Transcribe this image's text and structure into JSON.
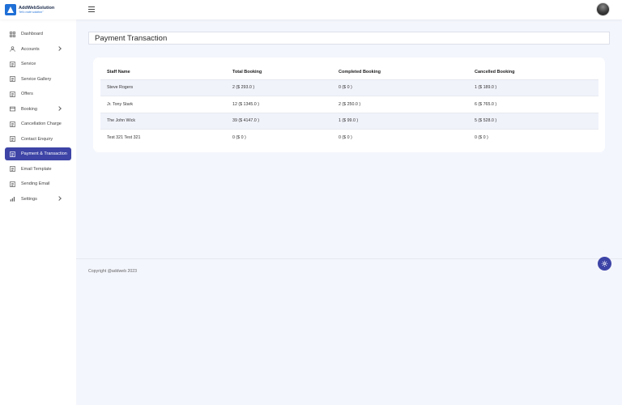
{
  "app": {
    "brand_name": "AddWebSolution",
    "brand_tagline": "\"let's code solution\""
  },
  "sidebar": {
    "items": [
      {
        "label": "Dashboard",
        "icon": "grid-icon",
        "has_children": false,
        "active": false
      },
      {
        "label": "Accounts",
        "icon": "user-icon",
        "has_children": true,
        "active": false
      },
      {
        "label": "Service",
        "icon": "document-icon",
        "has_children": false,
        "active": false
      },
      {
        "label": "Service Gallery",
        "icon": "document-icon",
        "has_children": false,
        "active": false
      },
      {
        "label": "Offers",
        "icon": "document-icon",
        "has_children": false,
        "active": false
      },
      {
        "label": "Booking",
        "icon": "card-icon",
        "has_children": true,
        "active": false
      },
      {
        "label": "Cancellation Charge",
        "icon": "document-icon",
        "has_children": false,
        "active": false
      },
      {
        "label": "Contact Enquiry",
        "icon": "document-icon",
        "has_children": false,
        "active": false
      },
      {
        "label": "Payment & Transaction",
        "icon": "document-icon",
        "has_children": false,
        "active": true
      },
      {
        "label": "Email Template",
        "icon": "document-icon",
        "has_children": false,
        "active": false
      },
      {
        "label": "Sending Email",
        "icon": "document-icon",
        "has_children": false,
        "active": false
      },
      {
        "label": "Settings",
        "icon": "bar-chart-icon",
        "has_children": true,
        "active": false
      }
    ]
  },
  "page": {
    "title": "Payment Transaction"
  },
  "table": {
    "headers": {
      "staff": "Staff Name",
      "total": "Total Booking",
      "completed": "Completed Booking",
      "cancelled": "Cancelled Booking"
    },
    "rows": [
      {
        "staff": "Steve Rogers",
        "total": "2 ($ 293.0 )",
        "completed": "0 ($ 0 )",
        "cancelled": "1 ($ 189.0 )"
      },
      {
        "staff": "Jr. Tony Stark",
        "total": "12 ($ 1345.0 )",
        "completed": "2 ($ 250.0 )",
        "cancelled": "6 ($ 765.0 )"
      },
      {
        "staff": "The John Wick",
        "total": "39 ($ 4147.0 )",
        "completed": "1 ($ 99.0 )",
        "cancelled": "5 ($ 528.0 )"
      },
      {
        "staff": "Test 321 Test 321",
        "total": "0 ($ 0 )",
        "completed": "0 ($ 0 )",
        "cancelled": "0 ($ 0 )"
      }
    ]
  },
  "footer": {
    "copyright": "Copyright @addweb 2023"
  },
  "colors": {
    "accent": "#3d44a6",
    "brand": "#1f6fd6",
    "background": "#f4f6fd"
  },
  "icons": {
    "menu": "hamburger-icon",
    "fab": "gear-icon"
  }
}
